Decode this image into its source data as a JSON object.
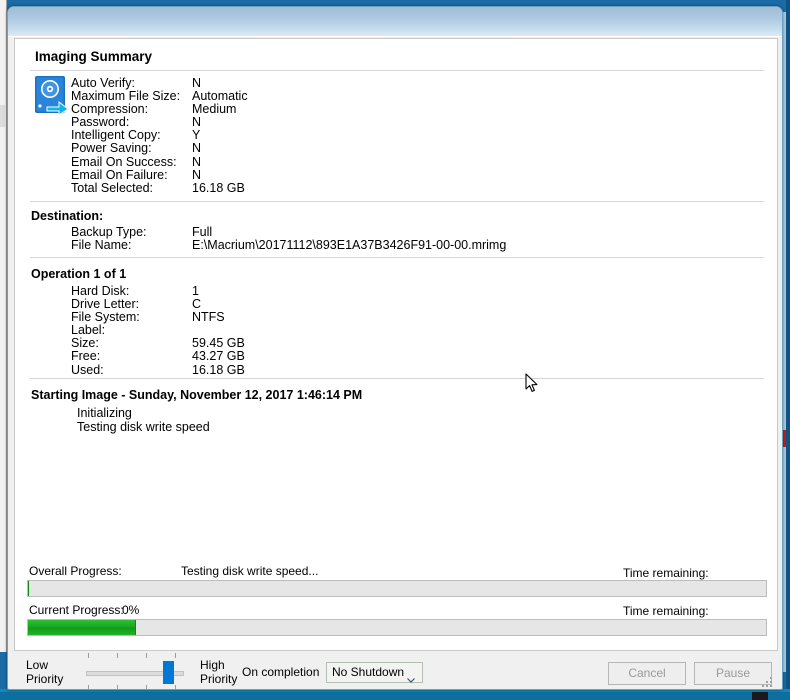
{
  "window": {
    "title": "",
    "page_title": "Imaging Summary"
  },
  "summary": {
    "icon": "hard-disk-backup-icon",
    "rows": [
      {
        "label": "Auto Verify:",
        "value": "N"
      },
      {
        "label": "Maximum File Size:",
        "value": "Automatic"
      },
      {
        "label": "Compression:",
        "value": "Medium"
      },
      {
        "label": "Password:",
        "value": "N"
      },
      {
        "label": "Intelligent Copy:",
        "value": "Y"
      },
      {
        "label": "Power Saving:",
        "value": "N"
      },
      {
        "label": "Email On Success:",
        "value": "N"
      },
      {
        "label": "Email On Failure:",
        "value": "N"
      },
      {
        "label": "Total Selected:",
        "value": "16.18 GB"
      }
    ]
  },
  "destination": {
    "heading": "Destination:",
    "rows": [
      {
        "label": "Backup Type:",
        "value": "Full"
      },
      {
        "label": "File Name:",
        "value": "E:\\Macrium\\20171112\\893E1A37B3426F91-00-00.mrimg"
      }
    ]
  },
  "operation": {
    "heading": "Operation 1 of 1",
    "rows": [
      {
        "label": "Hard Disk:",
        "value": "1"
      },
      {
        "label": "Drive Letter:",
        "value": "C"
      },
      {
        "label": "File System:",
        "value": "NTFS"
      },
      {
        "label": "Label:",
        "value": ""
      },
      {
        "label": "Size:",
        "value": "59.45 GB"
      },
      {
        "label": "Free:",
        "value": "43.27 GB"
      },
      {
        "label": "Used:",
        "value": "16.18 GB"
      }
    ]
  },
  "log": {
    "heading": "Starting Image - Sunday, November 12, 2017 1:46:14 PM",
    "lines": [
      "Initializing",
      "Testing disk write speed"
    ]
  },
  "progress": {
    "overall_label": "Overall Progress:",
    "overall_status": "Testing disk write speed...",
    "overall_time_label": "Time remaining:",
    "overall_time_value": "",
    "overall_percent": 0,
    "current_label": "Current Progress:",
    "current_percent_text": "0%",
    "current_time_label": "Time remaining:",
    "current_time_value": "",
    "current_fill_percent": 14.6,
    "fill_color": "#14a81b",
    "track_color": "#e6e6e6"
  },
  "footer": {
    "low_priority_line1": "Low",
    "low_priority_line2": "Priority",
    "high_priority_line1": "High",
    "high_priority_line2": "Priority",
    "slider_value_percent": 88,
    "on_completion_label": "On completion",
    "on_completion_value": "No Shutdown",
    "on_completion_options": [
      "No Shutdown"
    ],
    "cancel_label": "Cancel",
    "pause_label": "Pause",
    "cancel_enabled": false,
    "pause_enabled": false
  }
}
